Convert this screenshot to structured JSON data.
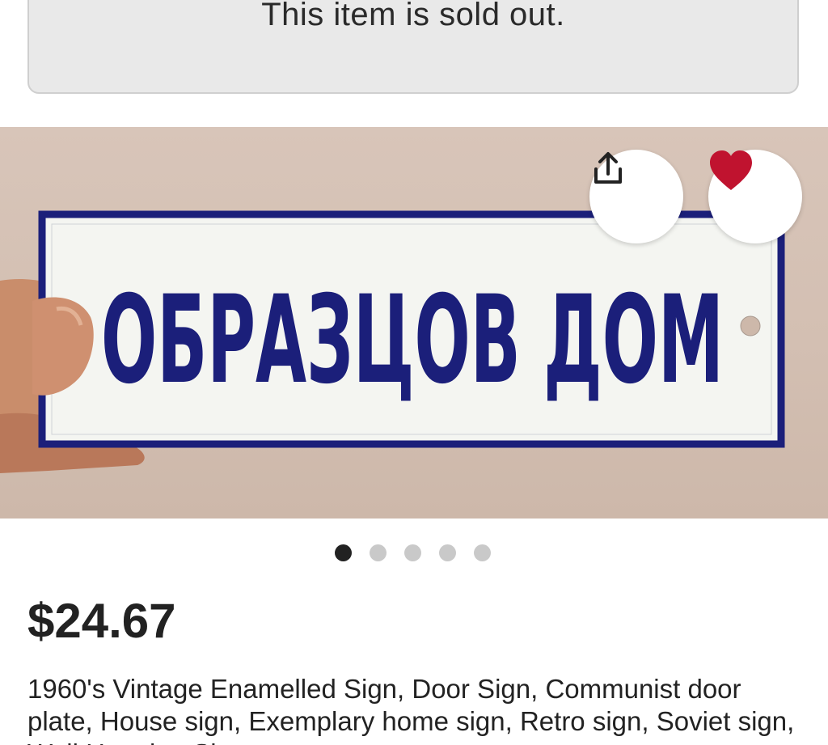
{
  "banner": {
    "sold_out_text": "This item is sold out."
  },
  "listing": {
    "sign_text": "ОБРАЗЦОВ ДОМ",
    "price": "$24.67",
    "title": "1960's Vintage Enamelled Sign, Door Sign, Communist door plate, House sign, Exemplary home sign, Retro sign, Soviet sign, Wall Hanging Sign"
  },
  "actions": {
    "share_icon": "share-icon",
    "favorite_icon": "heart-icon"
  },
  "carousel": {
    "total": 5,
    "active_index": 0
  },
  "colors": {
    "favorite_heart": "#c0132f",
    "sign_blue": "#1b1f7a",
    "banner_bg": "#e9e9e9"
  }
}
